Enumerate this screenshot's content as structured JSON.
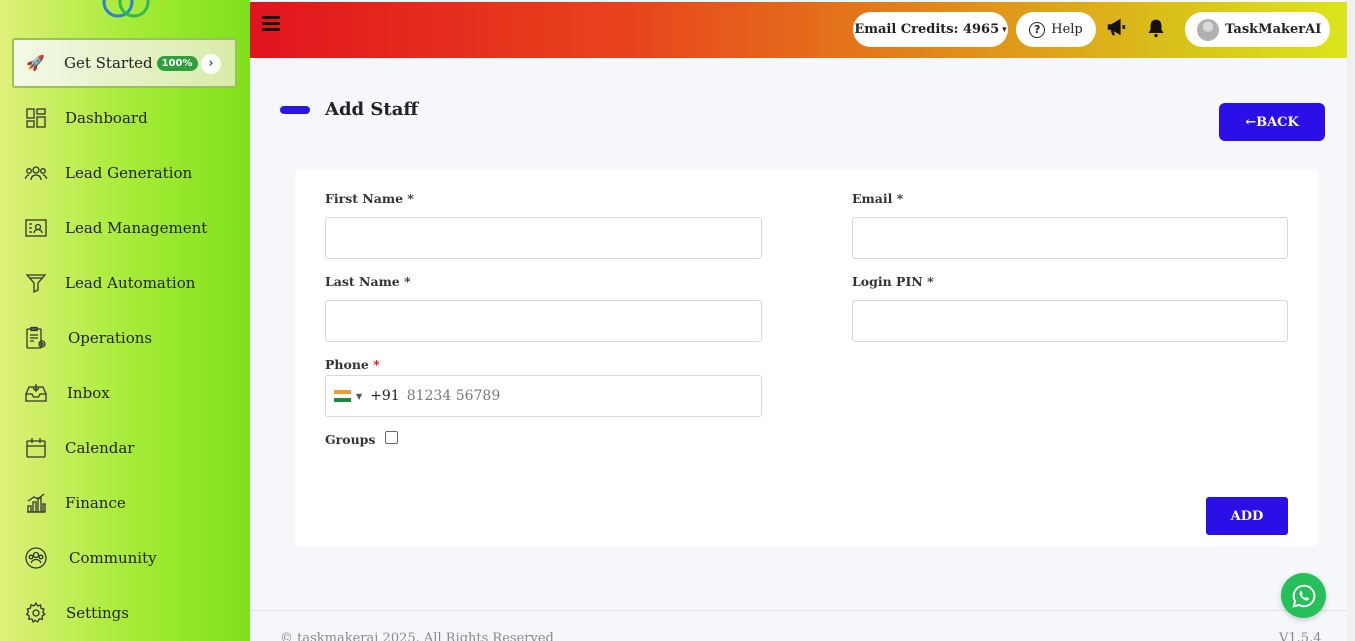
{
  "sidebar": {
    "get_started": {
      "label": "Get Started",
      "badge": "100%",
      "arrow": "›"
    },
    "items": [
      {
        "label": "Dashboard",
        "icon": "dashboard-icon"
      },
      {
        "label": "Lead Generation",
        "icon": "people-icon"
      },
      {
        "label": "Lead Management",
        "icon": "contact-card-icon"
      },
      {
        "label": "Lead Automation",
        "icon": "funnel-icon"
      },
      {
        "label": "Operations",
        "icon": "clipboard-gear-icon"
      },
      {
        "label": "Inbox",
        "icon": "inbox-icon"
      },
      {
        "label": "Calendar",
        "icon": "calendar-icon"
      },
      {
        "label": "Finance",
        "icon": "finance-chart-icon"
      },
      {
        "label": "Community",
        "icon": "community-icon"
      },
      {
        "label": "Settings",
        "icon": "gear-icon"
      }
    ]
  },
  "topbar": {
    "email_credits": "Email Credits: 4965",
    "credits_caret": "▾",
    "help_label": "Help",
    "help_icon": "?",
    "user_name": "TaskMakerAI"
  },
  "page": {
    "title": "Add Staff",
    "back_label": "←BACK"
  },
  "form": {
    "first_name_label": "First Name *",
    "email_label": "Email *",
    "last_name_label": "Last Name *",
    "login_pin_label": "Login PIN *",
    "phone_label": "Phone",
    "phone_required": "*",
    "dial_code": "+91",
    "phone_placeholder": "81234 56789",
    "groups_label": "Groups",
    "add_label": "ADD"
  },
  "footer": {
    "copyright": "© taskmakerai 2025. All Rights Reserved",
    "version": "V1.5.4"
  },
  "colors": {
    "primary_button": "#2a0fe6",
    "whatsapp": "#25c05a",
    "badge": "#2e9f3e"
  }
}
